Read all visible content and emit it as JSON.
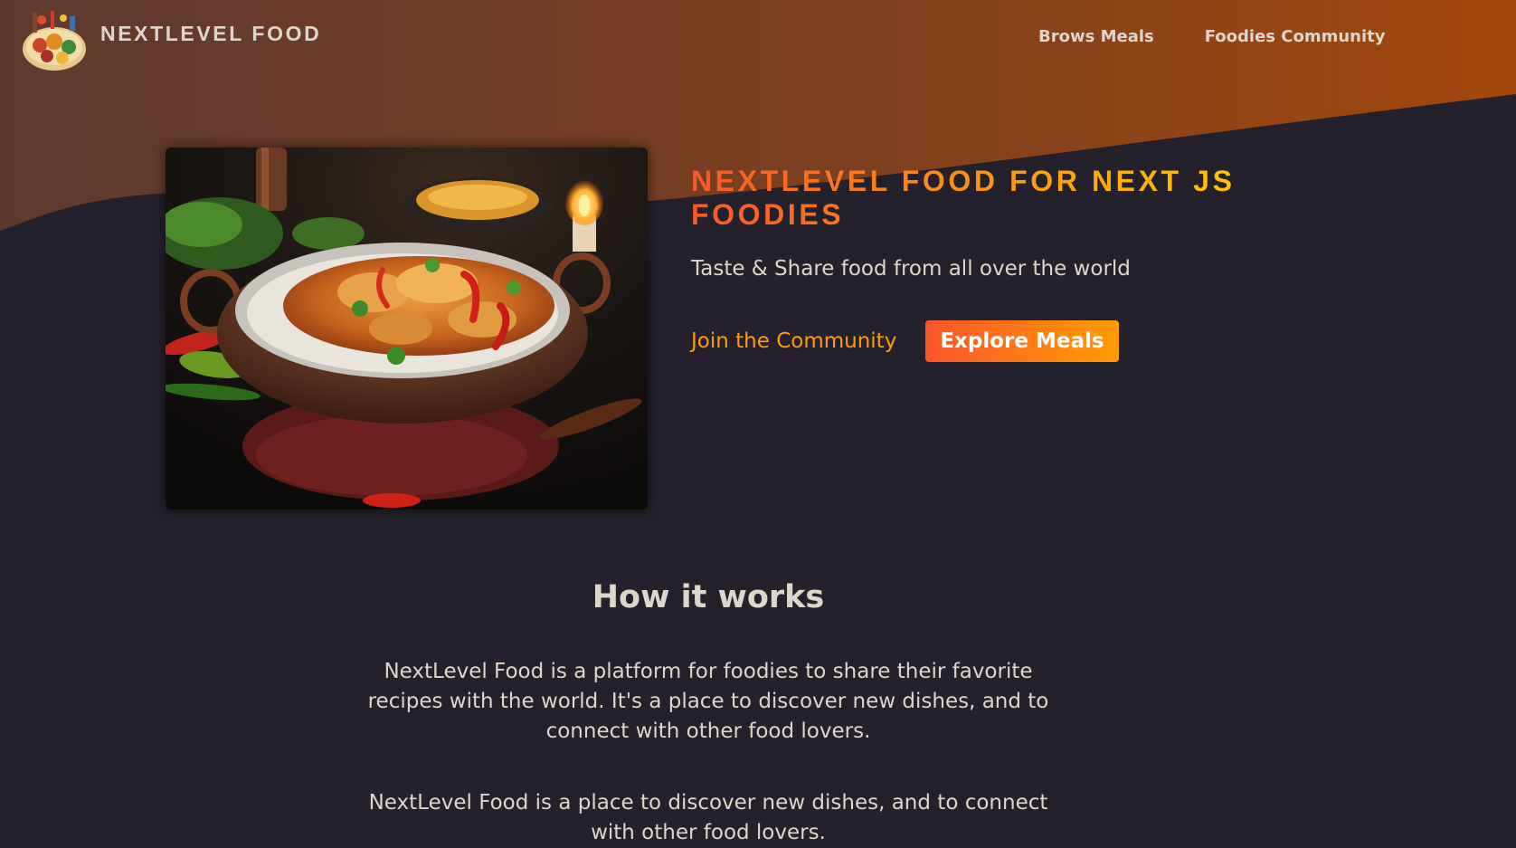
{
  "header": {
    "logo_alt": "NextLevel Food logo - a plate with food",
    "brand": "NEXTLEVEL FOOD",
    "nav": [
      {
        "label": "Brows Meals"
      },
      {
        "label": "Foodies Community"
      }
    ]
  },
  "hero": {
    "image_alt": "A bowl of curry with rice, chili peppers and herbs",
    "title": "NEXTLEVEL FOOD FOR NEXT JS FOODIES",
    "tagline": "Taste & Share food from all over the world",
    "cta_community": "Join the Community",
    "cta_explore": "Explore Meals"
  },
  "how_it_works": {
    "title": "How it works",
    "paragraph1": "NextLevel Food is a platform for foodies to share their favorite recipes with the world. It's a place to discover new dishes, and to connect with other food lovers.",
    "paragraph2": "NextLevel Food is a place to discover new dishes, and to connect with other food lovers."
  },
  "colors": {
    "background": "#24212c",
    "header_gradient_start": "#6a3a25",
    "header_gradient_end": "#a34a0d",
    "accent_orange": "#f9572a",
    "accent_yellow": "#ffc905",
    "link_orange": "#ff9b05",
    "text": "#ddd6cb"
  }
}
